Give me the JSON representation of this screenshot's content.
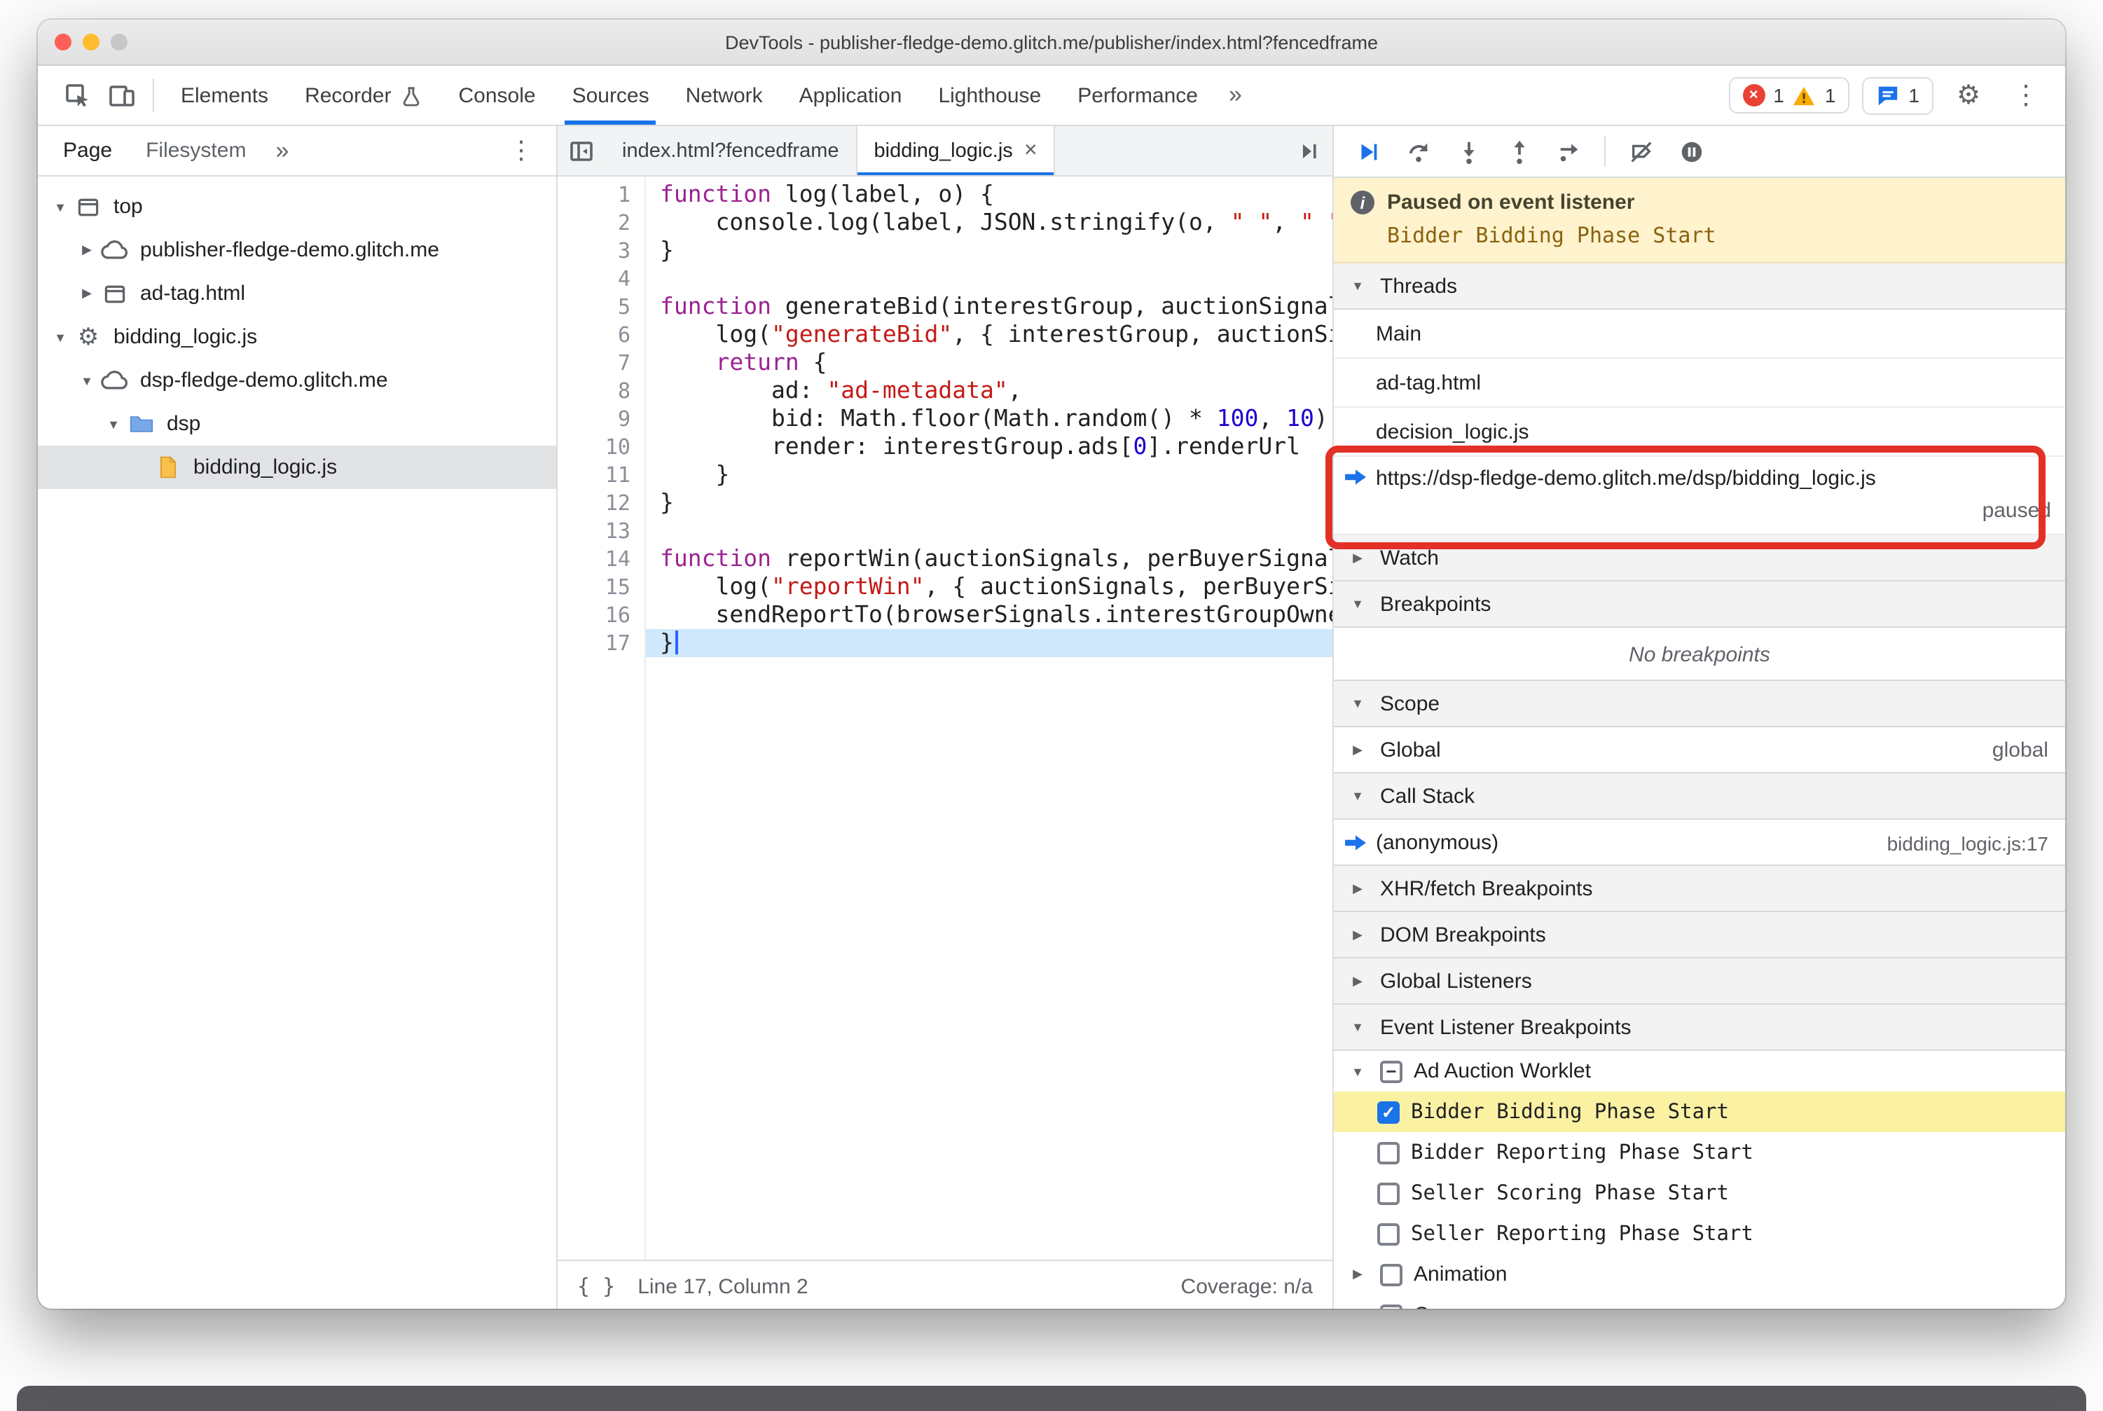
{
  "window": {
    "title": "DevTools - publisher-fledge-demo.glitch.me/publisher/index.html?fencedframe"
  },
  "toolbar": {
    "tabs": [
      {
        "label": "Elements"
      },
      {
        "label": "Recorder",
        "icon": "flask-icon"
      },
      {
        "label": "Console"
      },
      {
        "label": "Sources",
        "active": true
      },
      {
        "label": "Network"
      },
      {
        "label": "Application"
      },
      {
        "label": "Lighthouse"
      },
      {
        "label": "Performance"
      }
    ],
    "more_tabs_label": "»",
    "badges": {
      "errors": "1",
      "warnings": "1",
      "issues": "1"
    }
  },
  "navigator": {
    "tabs": [
      {
        "label": "Page",
        "active": true
      },
      {
        "label": "Filesystem"
      }
    ],
    "more_label": "»",
    "tree": [
      {
        "label": "top",
        "icon": "frame-icon",
        "expander": "open",
        "indent": 0
      },
      {
        "label": "publisher-fledge-demo.glitch.me",
        "icon": "cloud-icon",
        "expander": "closed",
        "indent": 1
      },
      {
        "label": "ad-tag.html",
        "icon": "frame-icon",
        "expander": "closed",
        "indent": 1
      },
      {
        "label": "bidding_logic.js",
        "icon": "worklet-gear-icon",
        "expander": "open",
        "indent": 0
      },
      {
        "label": "dsp-fledge-demo.glitch.me",
        "icon": "cloud-icon",
        "expander": "open",
        "indent": 1
      },
      {
        "label": "dsp",
        "icon": "folder-icon",
        "expander": "open",
        "indent": 2
      },
      {
        "label": "bidding_logic.js",
        "icon": "js-file-icon",
        "expander": "none",
        "indent": 3,
        "selected": true
      }
    ]
  },
  "editor": {
    "tabs": [
      {
        "label": "index.html?fencedframe"
      },
      {
        "label": "bidding_logic.js",
        "active": true,
        "closable": true
      }
    ],
    "code": [
      {
        "n": 1,
        "tokens": [
          [
            "k",
            "function"
          ],
          [
            "d",
            " log(label, o) {"
          ]
        ]
      },
      {
        "n": 2,
        "tokens": [
          [
            "d",
            "    console.log(label, JSON.stringify(o, "
          ],
          [
            "s",
            "\" \""
          ],
          [
            "d",
            ", "
          ],
          [
            "s",
            "\" \""
          ],
          [
            "d",
            ")"
          ]
        ]
      },
      {
        "n": 3,
        "tokens": [
          [
            "d",
            "}"
          ]
        ]
      },
      {
        "n": 4,
        "tokens": []
      },
      {
        "n": 5,
        "tokens": [
          [
            "k",
            "function"
          ],
          [
            "d",
            " generateBid(interestGroup, auctionSignal"
          ]
        ]
      },
      {
        "n": 6,
        "tokens": [
          [
            "d",
            "    log("
          ],
          [
            "s",
            "\"generateBid\""
          ],
          [
            "d",
            ", { interestGroup, auctionSi"
          ]
        ]
      },
      {
        "n": 7,
        "tokens": [
          [
            "d",
            "    "
          ],
          [
            "k",
            "return"
          ],
          [
            "d",
            " {"
          ]
        ]
      },
      {
        "n": 8,
        "tokens": [
          [
            "d",
            "        ad: "
          ],
          [
            "s",
            "\"ad-metadata\""
          ],
          [
            "d",
            ","
          ]
        ]
      },
      {
        "n": 9,
        "tokens": [
          [
            "d",
            "        bid: Math.floor(Math.random() * "
          ],
          [
            "n2",
            "100"
          ],
          [
            "d",
            ", "
          ],
          [
            "n2",
            "10"
          ],
          [
            "d",
            "),"
          ]
        ]
      },
      {
        "n": 10,
        "tokens": [
          [
            "d",
            "        render: interestGroup.ads["
          ],
          [
            "n2",
            "0"
          ],
          [
            "d",
            "].renderUrl"
          ]
        ]
      },
      {
        "n": 11,
        "tokens": [
          [
            "d",
            "    }"
          ]
        ]
      },
      {
        "n": 12,
        "tokens": [
          [
            "d",
            "}"
          ]
        ]
      },
      {
        "n": 13,
        "tokens": []
      },
      {
        "n": 14,
        "tokens": [
          [
            "k",
            "function"
          ],
          [
            "d",
            " reportWin(auctionSignals, perBuyerSignal"
          ]
        ]
      },
      {
        "n": 15,
        "tokens": [
          [
            "d",
            "    log("
          ],
          [
            "s",
            "\"reportWin\""
          ],
          [
            "d",
            ", { auctionSignals, perBuyerSi"
          ]
        ]
      },
      {
        "n": 16,
        "tokens": [
          [
            "d",
            "    sendReportTo(browserSignals.interestGroupOwne"
          ]
        ]
      },
      {
        "n": 17,
        "tokens": [
          [
            "d",
            "}"
          ]
        ],
        "exec": true
      }
    ],
    "status": {
      "line_col": "Line 17, Column 2",
      "coverage": "Coverage: n/a"
    }
  },
  "debugger": {
    "toolbar_icons": [
      "resume-icon",
      "step-over-icon",
      "step-into-icon",
      "step-out-icon",
      "step-icon",
      "deactivate-breakpoints-icon",
      "pause-on-exceptions-icon"
    ],
    "banner": {
      "title": "Paused on event listener",
      "subtitle": "Bidder Bidding Phase Start"
    },
    "threads_header": "Threads",
    "threads": [
      {
        "label": "Main"
      },
      {
        "label": "ad-tag.html"
      },
      {
        "label": "decision_logic.js"
      },
      {
        "label": "https://dsp-fledge-demo.glitch.me/dsp/bidding_logic.js",
        "status": "paused",
        "current": true
      }
    ],
    "watch_header": "Watch",
    "breakpoints_header": "Breakpoints",
    "no_breakpoints": "No breakpoints",
    "scope_header": "Scope",
    "scope_rows": [
      {
        "label": "Global",
        "value": "global"
      }
    ],
    "callstack_header": "Call Stack",
    "callstack_rows": [
      {
        "label": "(anonymous)",
        "location": "bidding_logic.js:17",
        "current": true
      }
    ],
    "xhr_header": "XHR/fetch Breakpoints",
    "dom_header": "DOM Breakpoints",
    "global_listeners_header": "Global Listeners",
    "elb_header": "Event Listener Breakpoints",
    "event_breakpoints": [
      {
        "label": "Ad Auction Worklet",
        "checkbox": "indeterminate",
        "expander": "open",
        "indent": 0
      },
      {
        "label": "Bidder Bidding Phase Start",
        "checkbox": "checked",
        "indent": 1,
        "highlighted": true
      },
      {
        "label": "Bidder Reporting Phase Start",
        "checkbox": "unchecked",
        "indent": 1
      },
      {
        "label": "Seller Scoring Phase Start",
        "checkbox": "unchecked",
        "indent": 1
      },
      {
        "label": "Seller Reporting Phase Start",
        "checkbox": "unchecked",
        "indent": 1
      },
      {
        "label": "Animation",
        "checkbox": "unchecked",
        "expander": "closed",
        "indent": 0
      },
      {
        "label": "Canvas",
        "checkbox": "unchecked",
        "expander": "closed",
        "indent": 0
      }
    ]
  }
}
